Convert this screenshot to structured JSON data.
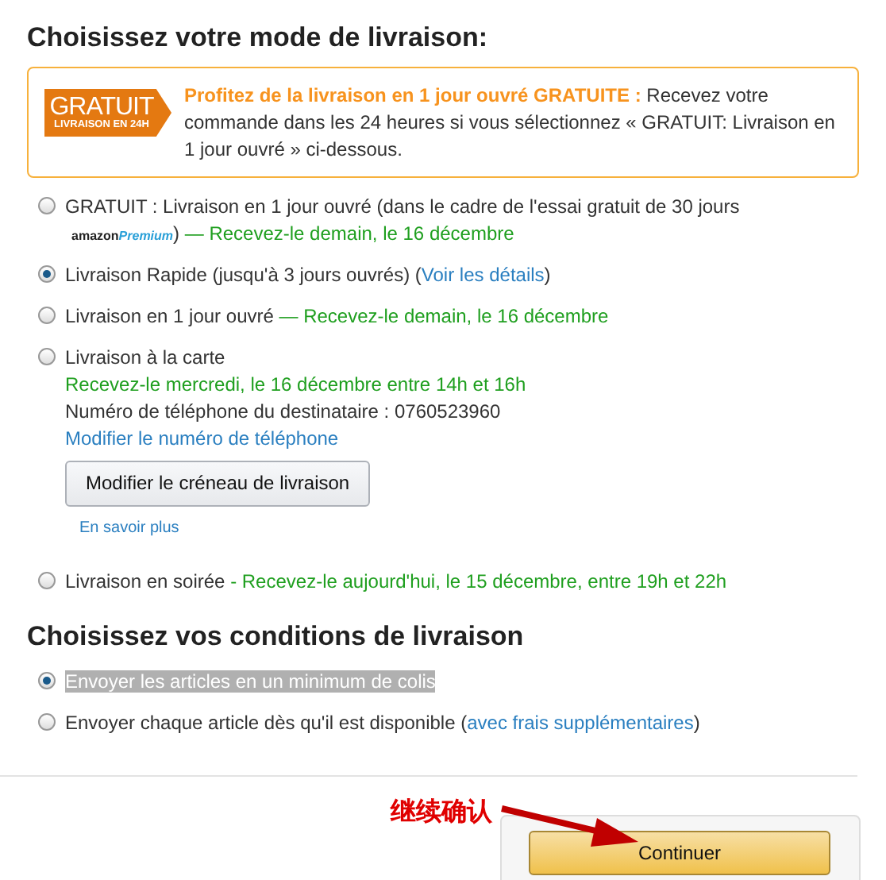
{
  "heading": "Choisissez votre mode de livraison:",
  "promo": {
    "badge_title": "GRATUIT",
    "badge_subtitle": "LIVRAISON EN 24H",
    "highlight": "Profitez de la livraison en 1 jour ouvré GRATUITE :",
    "text": "Recevez votre commande dans les 24 heures si vous sélectionnez « GRATUIT: Livraison en 1 jour ouvré » ci-dessous."
  },
  "delivery_options": [
    {
      "selected": false,
      "segments": [
        {
          "kind": "text",
          "text": "GRATUIT : Livraison en 1 jour ouvré (dans le cadre de l'essai gratuit de 30 jours "
        },
        {
          "kind": "logo",
          "brand": "amazon",
          "tier": "Premium"
        },
        {
          "kind": "text",
          "text": ")"
        },
        {
          "kind": "note",
          "text": " — Recevez-le demain, le 16 décembre"
        }
      ]
    },
    {
      "selected": true,
      "segments": [
        {
          "kind": "text",
          "text": "Livraison Rapide (jusqu'à 3 jours ouvrés) ("
        },
        {
          "kind": "link",
          "text": "Voir les détails"
        },
        {
          "kind": "text",
          "text": ")"
        }
      ]
    },
    {
      "selected": false,
      "segments": [
        {
          "kind": "text",
          "text": "Livraison en 1 jour ouvré "
        },
        {
          "kind": "note",
          "text": "— Recevez-le demain, le 16 décembre"
        }
      ]
    },
    {
      "selected": false,
      "segments": [
        {
          "kind": "text",
          "text": "Livraison à la carte"
        }
      ],
      "lines": [
        {
          "kind": "note",
          "text": "Recevez-le mercredi, le 16 décembre entre 14h et 16h"
        },
        {
          "kind": "text",
          "text": "Numéro de téléphone du destinataire : 0760523960"
        },
        {
          "kind": "link",
          "text": "Modifier le numéro de téléphone"
        }
      ],
      "button": "Modifier le créneau de livraison",
      "help_link": "En savoir plus"
    },
    {
      "selected": false,
      "segments": [
        {
          "kind": "text",
          "text": "Livraison en soirée "
        },
        {
          "kind": "note",
          "text": "- Recevez-le aujourd'hui, le 15 décembre, entre 19h et 22h"
        }
      ]
    }
  ],
  "conditions_heading": "Choisissez vos conditions de livraison",
  "conditions": [
    {
      "selected": true,
      "highlighted": true,
      "segments": [
        {
          "kind": "text",
          "text": "Envoyer les articles en un minimum de colis"
        }
      ]
    },
    {
      "selected": false,
      "highlighted": false,
      "segments": [
        {
          "kind": "text",
          "text": "Envoyer chaque article dès qu'il est disponible ("
        },
        {
          "kind": "link",
          "text": "avec frais supplémentaires"
        },
        {
          "kind": "text",
          "text": ")"
        }
      ]
    }
  ],
  "annotation": "继续确认",
  "continue_button": "Continuer"
}
